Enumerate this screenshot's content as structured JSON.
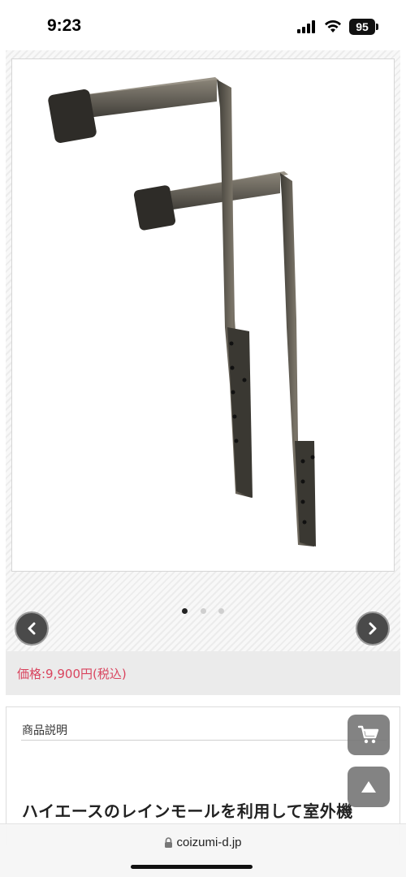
{
  "status_bar": {
    "time": "9:23",
    "battery": "95",
    "icons": [
      "signal-icon",
      "wifi-icon",
      "battery-icon"
    ]
  },
  "product": {
    "image_alt": "rain-moulding outdoor unit brackets",
    "carousel": {
      "total_slides": 3,
      "active_index": 0
    },
    "prev_icon": "chevron-left-icon",
    "next_icon": "chevron-right-icon"
  },
  "price": {
    "label": "価格:9,900円(税込)",
    "color": "#d9445e"
  },
  "description": {
    "heading": "商品説明",
    "title": "ハイエースのレインモールを利用して室外機"
  },
  "floating_buttons": {
    "cart_icon": "cart-icon",
    "scroll_top_icon": "arrow-up-icon"
  },
  "browser": {
    "url": "coizumi-d.jp",
    "lock_icon": "lock-icon"
  }
}
